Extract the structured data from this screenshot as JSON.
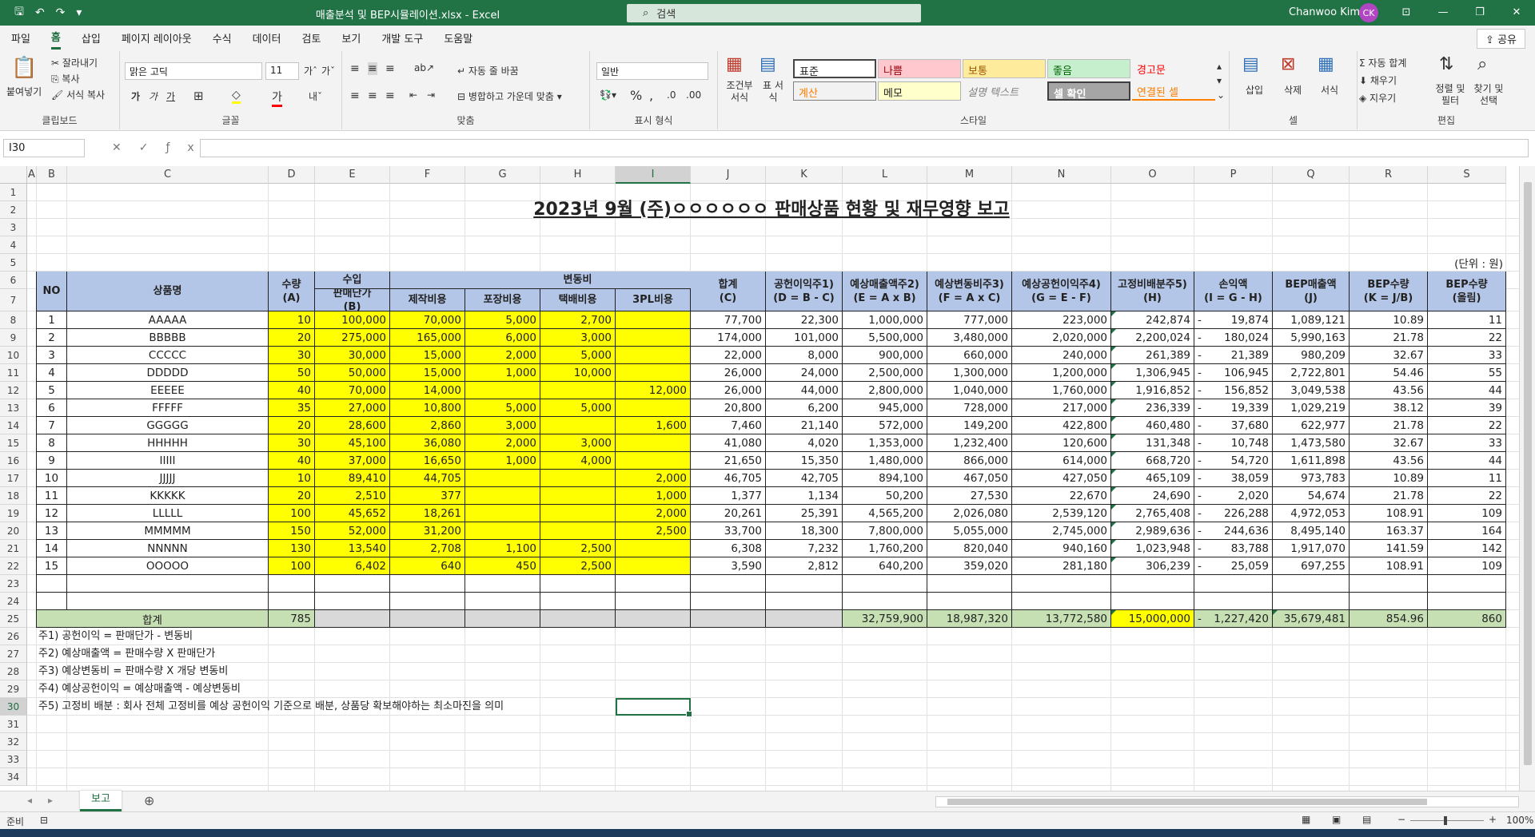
{
  "window": {
    "title": "매출분석 및 BEP시뮬레이션.xlsx  -  Excel",
    "search_placeholder": "검색",
    "user_name": "Chanwoo Kim",
    "user_initials": "CK"
  },
  "menu": {
    "tabs": [
      "파일",
      "홈",
      "삽입",
      "페이지 레이아웃",
      "수식",
      "데이터",
      "검토",
      "보기",
      "개발 도구",
      "도움말"
    ],
    "active": "홈",
    "share": "공유"
  },
  "ribbon": {
    "clipboard": {
      "paste": "붙여넣기",
      "cut": "잘라내기",
      "copy": "복사",
      "format_painter": "서식 복사",
      "label": "클립보드"
    },
    "font": {
      "name": "맑은 고딕",
      "size": "11",
      "label": "글꼴"
    },
    "alignment": {
      "wrap": "자동 줄 바꿈",
      "merge": "병합하고 가운데 맞춤",
      "label": "맞춤"
    },
    "number": {
      "format": "일반",
      "label": "표시 형식"
    },
    "styles": {
      "conditional": "조건부 서식",
      "table": "표 서식",
      "cells": [
        "표준",
        "나쁨",
        "보통",
        "좋음",
        "경고문",
        "계산",
        "메모",
        "설명 텍스트",
        "셀 확인",
        "연결된 셀"
      ],
      "label": "스타일"
    },
    "cells_group": {
      "insert": "삽입",
      "delete": "삭제",
      "format": "서식",
      "label": "셀"
    },
    "editing": {
      "autosum": "자동 합계",
      "fill": "채우기",
      "clear": "지우기",
      "sort": "정렬 및 필터",
      "find": "찾기 및 선택",
      "label": "편집"
    }
  },
  "formula_bar": {
    "name_box": "I30",
    "formula": ""
  },
  "columns": [
    "A",
    "B",
    "C",
    "D",
    "E",
    "F",
    "G",
    "H",
    "I",
    "J",
    "K",
    "L",
    "M",
    "N",
    "O",
    "P",
    "Q",
    "R",
    "S"
  ],
  "rows": [
    "1",
    "2",
    "3",
    "4",
    "5",
    "6",
    "7",
    "8",
    "9",
    "10",
    "11",
    "12",
    "13",
    "14",
    "15",
    "16",
    "17",
    "18",
    "19",
    "20",
    "21",
    "22",
    "23",
    "24",
    "25",
    "26",
    "27",
    "28",
    "29",
    "30",
    "31",
    "32",
    "33",
    "34"
  ],
  "report": {
    "title": "2023년 9월 (주)ㅇㅇㅇㅇㅇㅇ 판매상품 현황 및 재무영향 보고",
    "unit": "(단위 : 원)",
    "headers": {
      "no": "NO",
      "product": "상품명",
      "qty": [
        "수량",
        "(A)"
      ],
      "income": "수입",
      "price": [
        "판매단가",
        "(B)"
      ],
      "variable": "변동비",
      "make": "제작비용",
      "pack": "포장비용",
      "ship": "택배비용",
      "pl3": "3PL비용",
      "sum": [
        "합계",
        "(C)"
      ],
      "contrib": [
        "공헌이익주1)",
        "(D = B - C)"
      ],
      "sales": [
        "예상매출액주2)",
        "(E = A x B)"
      ],
      "varcost": [
        "예상변동비주3)",
        "(F = A x C)"
      ],
      "contrib_total": [
        "예상공헌이익주4)",
        "(G = E - F)"
      ],
      "fixed": [
        "고정비배분주5)",
        "(H)"
      ],
      "pl": [
        "손익액",
        "(I = G - H)"
      ],
      "bep_sales": [
        "BEP매출액",
        "(J)"
      ],
      "bep_qty": [
        "BEP수량",
        "(K = J/B)"
      ],
      "bep_round": [
        "BEP수량",
        "(올림)"
      ]
    },
    "rows": [
      [
        "1",
        "AAAAA",
        "10",
        "100,000",
        "70,000",
        "5,000",
        "2,700",
        "",
        "77,700",
        "22,300",
        "1,000,000",
        "777,000",
        "223,000",
        "242,874",
        "19,874",
        "1,089,121",
        "10.89",
        "11"
      ],
      [
        "2",
        "BBBBB",
        "20",
        "275,000",
        "165,000",
        "6,000",
        "3,000",
        "",
        "174,000",
        "101,000",
        "5,500,000",
        "3,480,000",
        "2,020,000",
        "2,200,024",
        "180,024",
        "5,990,163",
        "21.78",
        "22"
      ],
      [
        "3",
        "CCCCC",
        "30",
        "30,000",
        "15,000",
        "2,000",
        "5,000",
        "",
        "22,000",
        "8,000",
        "900,000",
        "660,000",
        "240,000",
        "261,389",
        "21,389",
        "980,209",
        "32.67",
        "33"
      ],
      [
        "4",
        "DDDDD",
        "50",
        "50,000",
        "15,000",
        "1,000",
        "10,000",
        "",
        "26,000",
        "24,000",
        "2,500,000",
        "1,300,000",
        "1,200,000",
        "1,306,945",
        "106,945",
        "2,722,801",
        "54.46",
        "55"
      ],
      [
        "5",
        "EEEEE",
        "40",
        "70,000",
        "14,000",
        "",
        "",
        "12,000",
        "26,000",
        "44,000",
        "2,800,000",
        "1,040,000",
        "1,760,000",
        "1,916,852",
        "156,852",
        "3,049,538",
        "43.56",
        "44"
      ],
      [
        "6",
        "FFFFF",
        "35",
        "27,000",
        "10,800",
        "5,000",
        "5,000",
        "",
        "20,800",
        "6,200",
        "945,000",
        "728,000",
        "217,000",
        "236,339",
        "19,339",
        "1,029,219",
        "38.12",
        "39"
      ],
      [
        "7",
        "GGGGG",
        "20",
        "28,600",
        "2,860",
        "3,000",
        "",
        "1,600",
        "7,460",
        "21,140",
        "572,000",
        "149,200",
        "422,800",
        "460,480",
        "37,680",
        "622,977",
        "21.78",
        "22"
      ],
      [
        "8",
        "HHHHH",
        "30",
        "45,100",
        "36,080",
        "2,000",
        "3,000",
        "",
        "41,080",
        "4,020",
        "1,353,000",
        "1,232,400",
        "120,600",
        "131,348",
        "10,748",
        "1,473,580",
        "32.67",
        "33"
      ],
      [
        "9",
        "IIIII",
        "40",
        "37,000",
        "16,650",
        "1,000",
        "4,000",
        "",
        "21,650",
        "15,350",
        "1,480,000",
        "866,000",
        "614,000",
        "668,720",
        "54,720",
        "1,611,898",
        "43.56",
        "44"
      ],
      [
        "10",
        "JJJJJ",
        "10",
        "89,410",
        "44,705",
        "",
        "",
        "2,000",
        "46,705",
        "42,705",
        "894,100",
        "467,050",
        "427,050",
        "465,109",
        "38,059",
        "973,783",
        "10.89",
        "11"
      ],
      [
        "11",
        "KKKKK",
        "20",
        "2,510",
        "377",
        "",
        "",
        "1,000",
        "1,377",
        "1,134",
        "50,200",
        "27,530",
        "22,670",
        "24,690",
        "2,020",
        "54,674",
        "21.78",
        "22"
      ],
      [
        "12",
        "LLLLL",
        "100",
        "45,652",
        "18,261",
        "",
        "",
        "2,000",
        "20,261",
        "25,391",
        "4,565,200",
        "2,026,080",
        "2,539,120",
        "2,765,408",
        "226,288",
        "4,972,053",
        "108.91",
        "109"
      ],
      [
        "13",
        "MMMMM",
        "150",
        "52,000",
        "31,200",
        "",
        "",
        "2,500",
        "33,700",
        "18,300",
        "7,800,000",
        "5,055,000",
        "2,745,000",
        "2,989,636",
        "244,636",
        "8,495,140",
        "163.37",
        "164"
      ],
      [
        "14",
        "NNNNN",
        "130",
        "13,540",
        "2,708",
        "1,100",
        "2,500",
        "",
        "6,308",
        "7,232",
        "1,760,200",
        "820,040",
        "940,160",
        "1,023,948",
        "83,788",
        "1,917,070",
        "141.59",
        "142"
      ],
      [
        "15",
        "OOOOO",
        "100",
        "6,402",
        "640",
        "450",
        "2,500",
        "",
        "3,590",
        "2,812",
        "640,200",
        "359,020",
        "281,180",
        "306,239",
        "25,059",
        "697,255",
        "108.91",
        "109"
      ]
    ],
    "total": {
      "label": "합계",
      "qty": "785",
      "sales": "32,759,900",
      "varcost": "18,987,320",
      "contrib_total": "13,772,580",
      "fixed": "15,000,000",
      "pl": "1,227,420",
      "bep_sales": "35,679,481",
      "bep_qty": "854.96",
      "bep_round": "860"
    },
    "minus_sign": "-",
    "notes": [
      "주1) 공헌이익 = 판매단가 - 변동비",
      "주2) 예상매출액 = 판매수량 X 판매단가",
      "주3) 예상변동비 = 판매수량 X 개당 변동비",
      "주4) 예상공헌이익 = 예상매출액 - 예상변동비",
      "주5) 고정비 배분 : 회사 전체 고정비를 예상 공헌이익 기준으로 배분, 상품당 확보해야하는 최소마진을 의미"
    ]
  },
  "sheet_tabs": [
    "보고"
  ],
  "status": {
    "ready": "준비",
    "zoom": "100%"
  },
  "colors": {
    "excel_green": "#217346",
    "header_blue": "#b4c6e7",
    "input_yellow": "#ffff00",
    "total_green": "#c6e0b4",
    "total_gray": "#d9d9d9"
  }
}
